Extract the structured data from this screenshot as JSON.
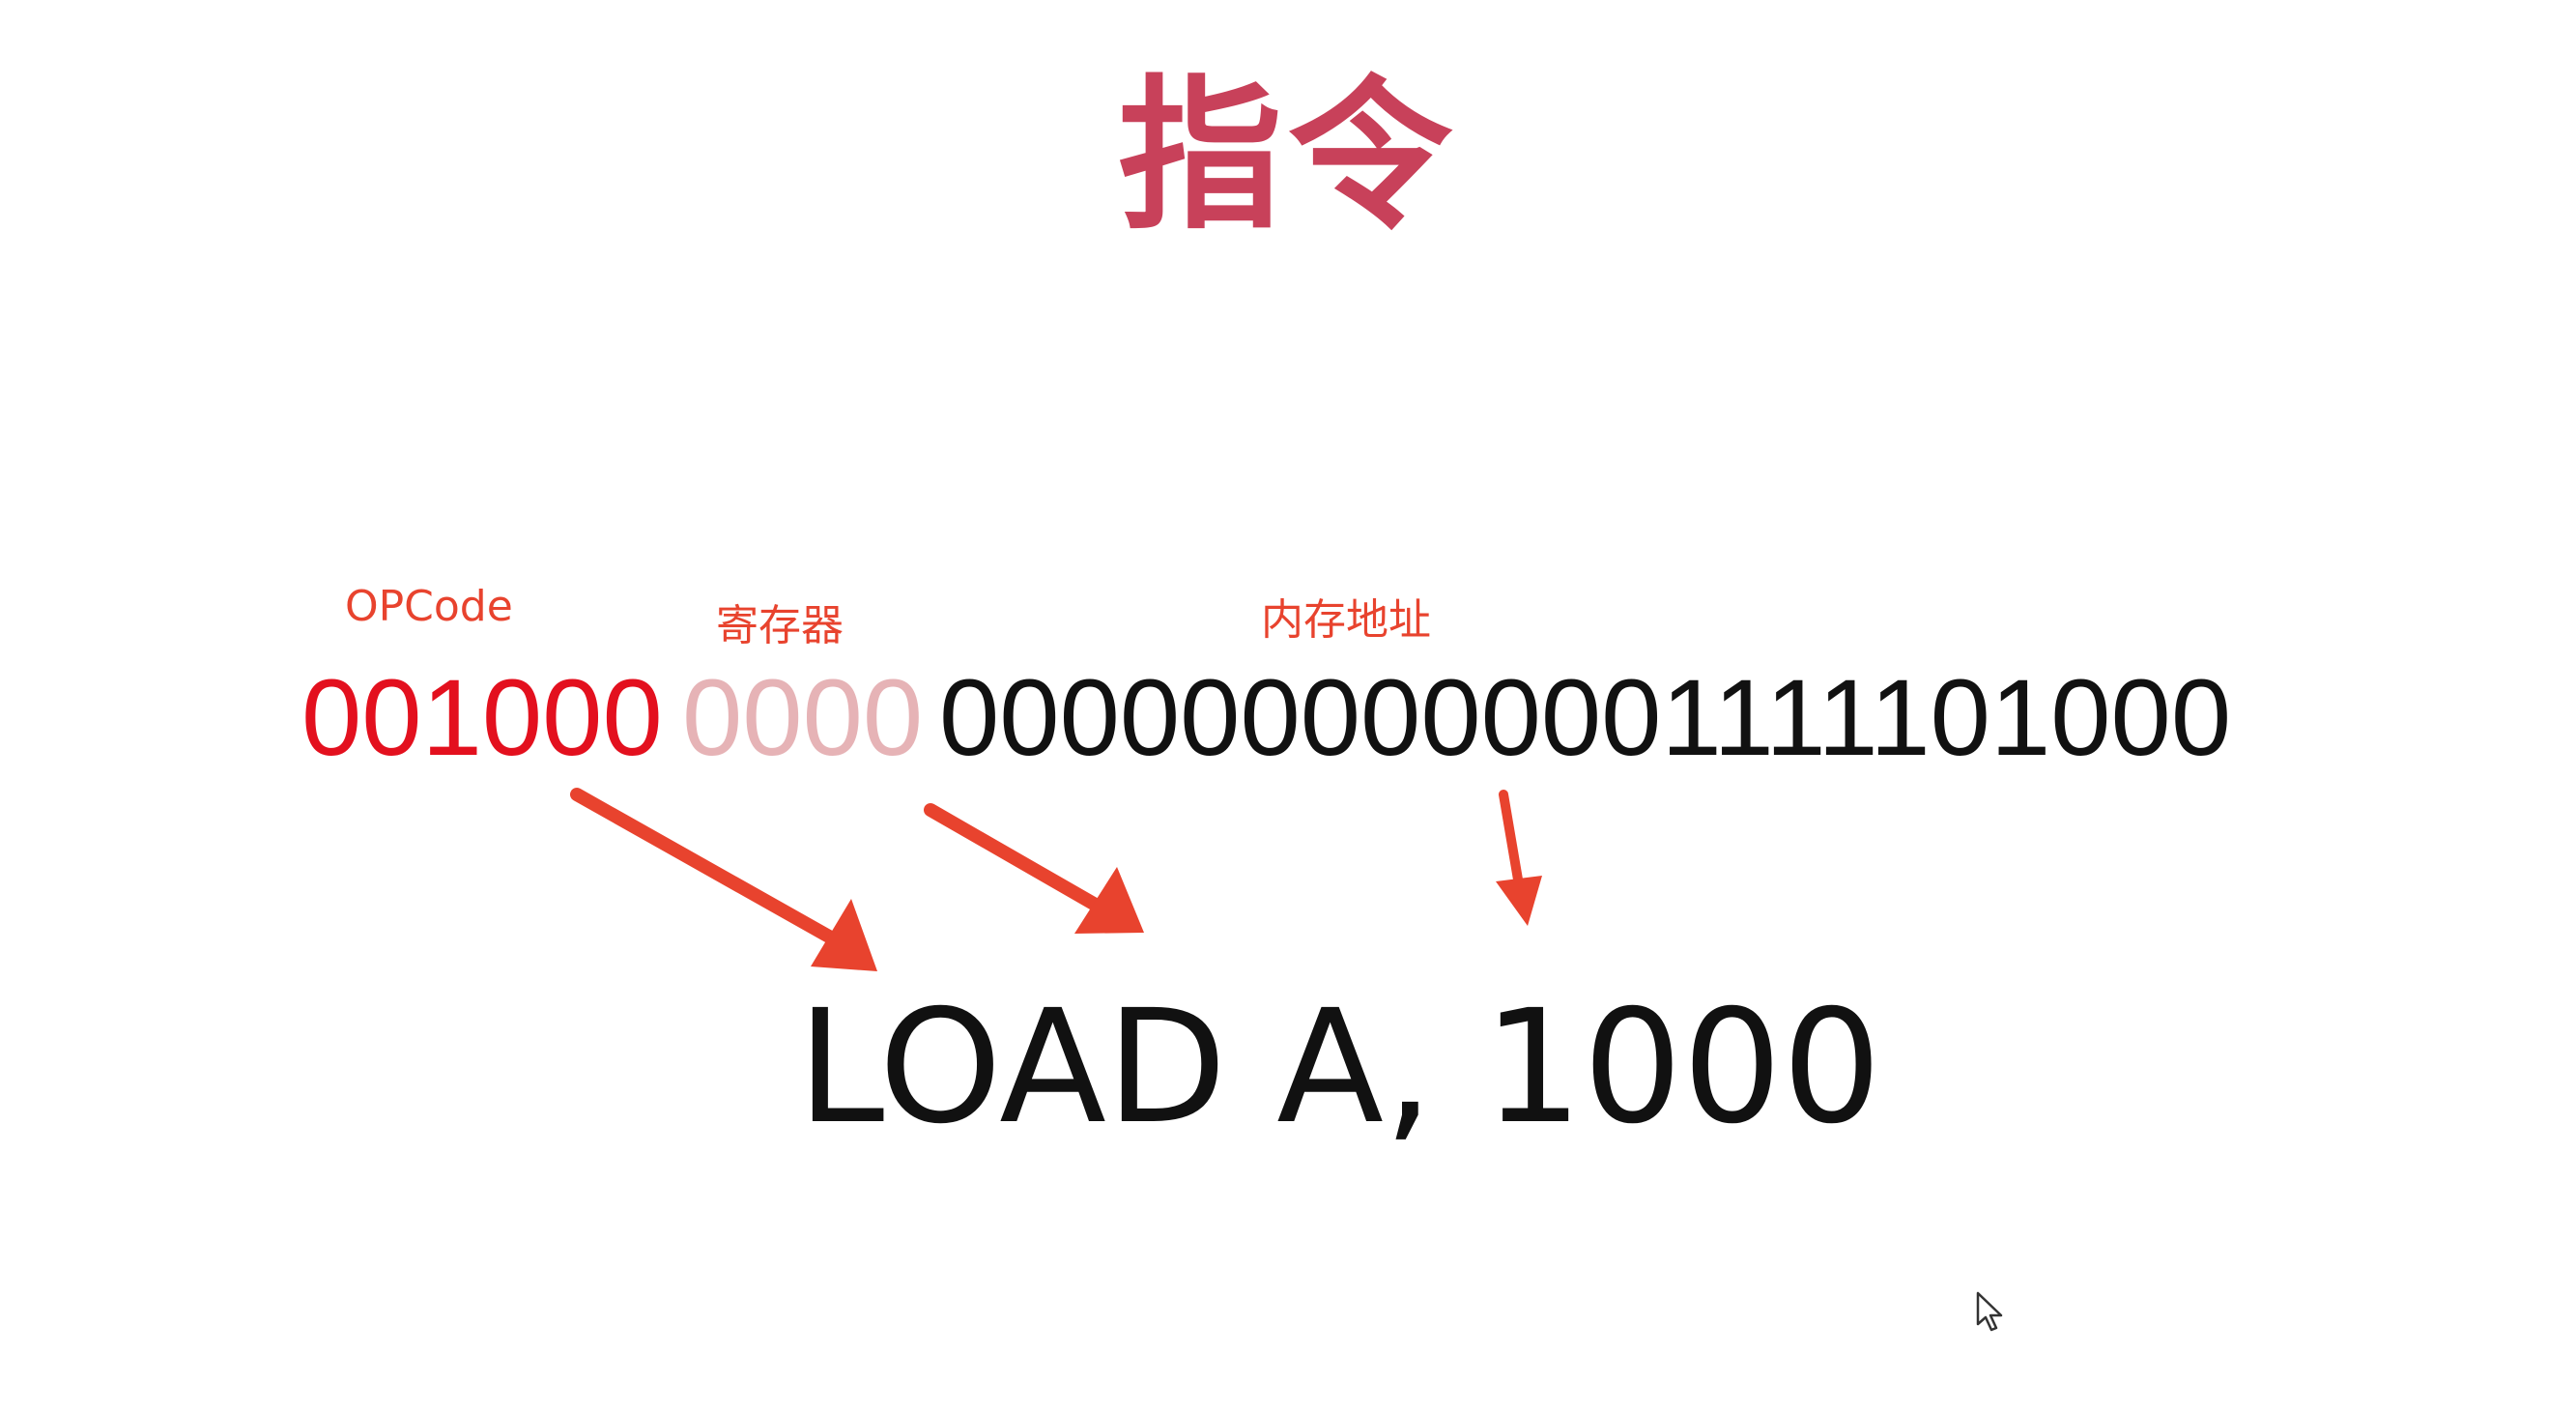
{
  "title": "指令",
  "labels": {
    "opcode": "OPCode",
    "register": "寄存器",
    "address": "内存地址"
  },
  "bits": {
    "opcode": "001000",
    "register": "0000",
    "address": "0000000000001111101000"
  },
  "instruction": "LOAD A, 1000",
  "colors": {
    "title": "#c8415a",
    "label": "#e8432e",
    "opcode_bits": "#e3101e",
    "register_bits": "#e6b3b6",
    "arrow": "#e8432e"
  },
  "icons": {
    "cursor": "mouse-pointer-icon"
  }
}
